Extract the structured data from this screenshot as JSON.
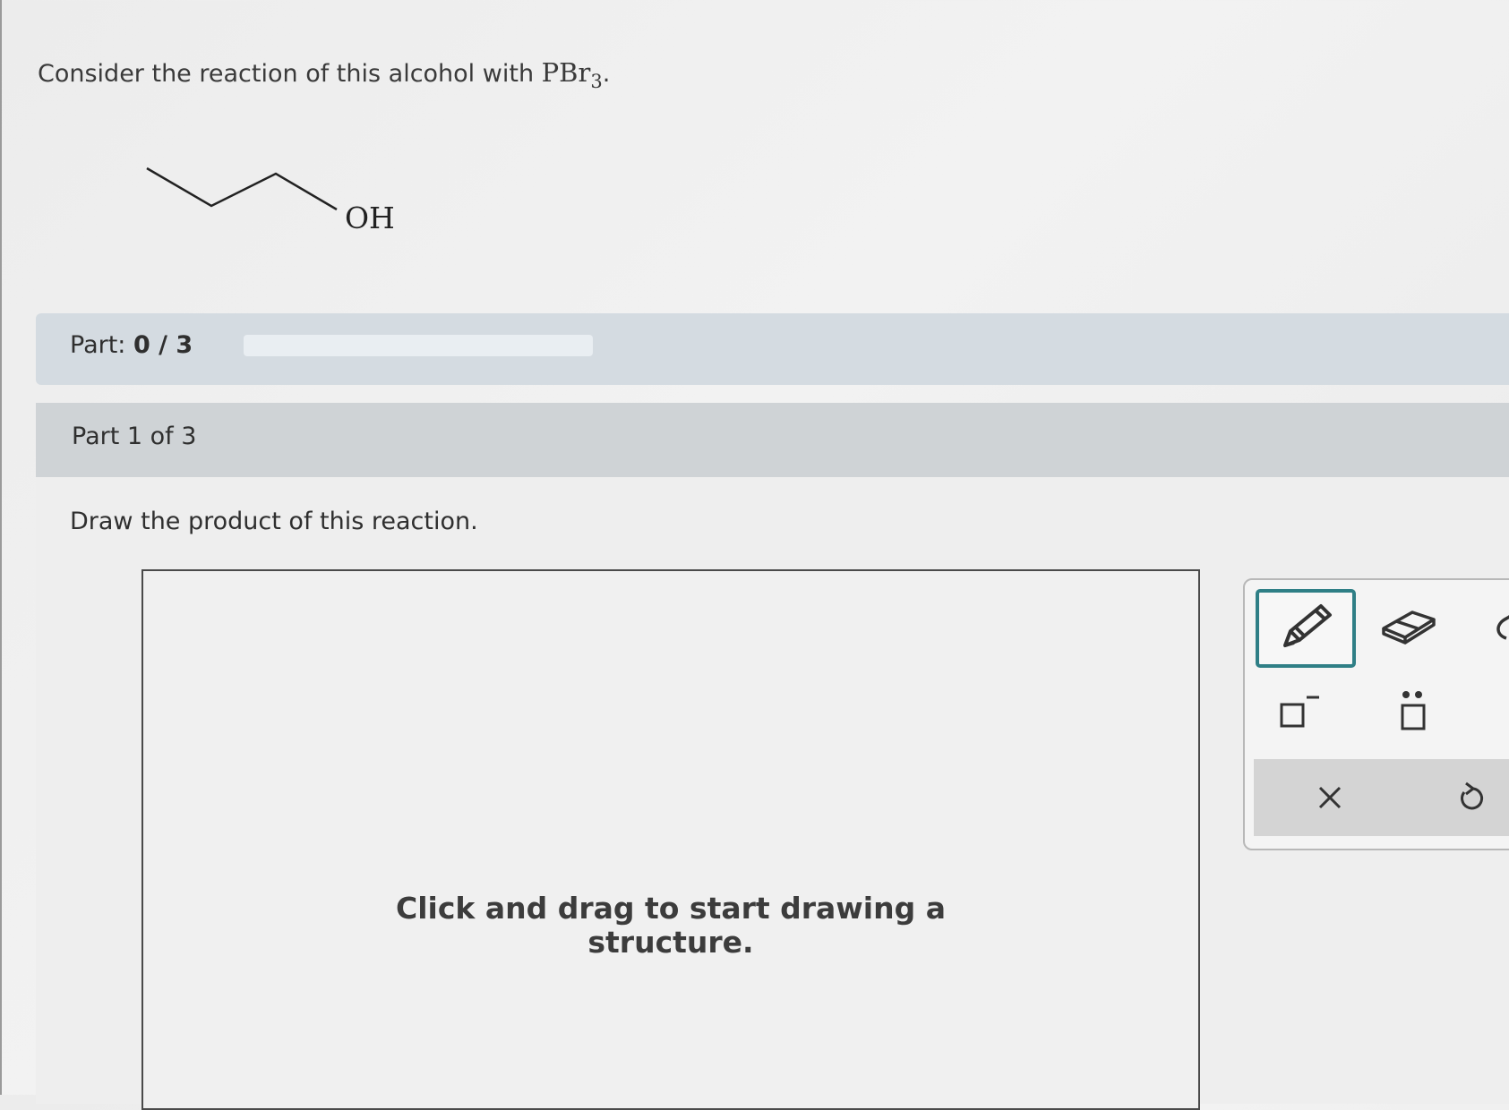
{
  "question": {
    "prefix": "Consider the reaction of this alcohol with ",
    "reagent": "PBr",
    "reagent_subscript": "3",
    "suffix": "."
  },
  "molecule": {
    "name": "propan-1-ol skeletal structure",
    "hydroxyl_label": "OH"
  },
  "progress": {
    "label": "Part: ",
    "count": "0 / 3",
    "fraction": 0
  },
  "part": {
    "title": "Part 1 of 3",
    "instruction": "Draw the product of this reaction."
  },
  "canvas": {
    "hint_line1": "Click and drag to start drawing a",
    "hint_line2": "structure."
  },
  "toolbar": {
    "tools": [
      {
        "id": "pencil",
        "icon": "pencil-icon",
        "selected": true
      },
      {
        "id": "eraser",
        "icon": "eraser-icon"
      },
      {
        "id": "lasso",
        "icon": "lasso-icon"
      },
      {
        "id": "charge",
        "icon": "charge-icon"
      },
      {
        "id": "lone-pair",
        "icon": "lone-pair-icon"
      },
      {
        "id": "clear",
        "icon": "close-icon"
      },
      {
        "id": "undo",
        "icon": "undo-icon"
      }
    ],
    "accent_color": "#2f7f86"
  }
}
